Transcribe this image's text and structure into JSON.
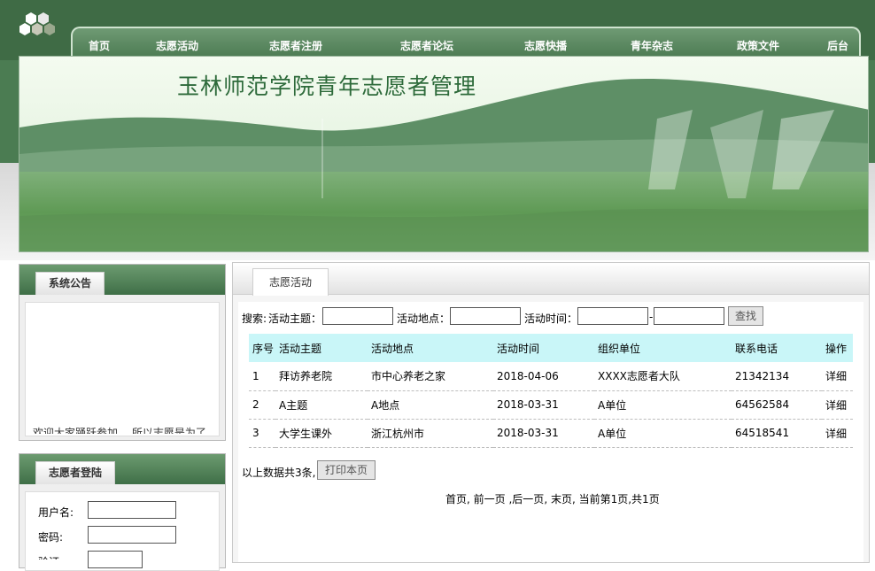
{
  "nav": {
    "items": [
      "首页",
      "志愿活动",
      "志愿者注册",
      "志愿者论坛",
      "志愿快播",
      "青年杂志",
      "政策文件",
      "后台"
    ]
  },
  "banner": {
    "title": "玉林师范学院青年志愿者管理"
  },
  "notice": {
    "title": "系统公告",
    "scroll_text": "欢迎大家踊跃参加，   所以志愿是为了"
  },
  "login": {
    "title": "志愿者登陆",
    "username_label": "用户名:",
    "password_label": "密码:",
    "captcha_label": "验证"
  },
  "main": {
    "tab": "志愿活动",
    "search": {
      "prefix": "搜索:",
      "topic_label": "活动主题：",
      "place_label": "活动地点：",
      "time_label": "活动时间：",
      "separator": "-",
      "button": "查找"
    },
    "table": {
      "headers": [
        "序号",
        "活动主题",
        "活动地点",
        "活动时间",
        "组织单位",
        "联系电话",
        "操作"
      ],
      "rows": [
        [
          "1",
          "拜访养老院",
          "市中心养老之家",
          "2018-04-06",
          "XXXX志愿者大队",
          "21342134",
          "详细"
        ],
        [
          "2",
          "A主题",
          "A地点",
          "2018-03-31",
          "A单位",
          "64562584",
          "详细"
        ],
        [
          "3",
          "大学生课外",
          "浙江杭州市",
          "2018-03-31",
          "A单位",
          "64518541",
          "详细"
        ]
      ]
    },
    "summary": "以上数据共3条,",
    "print_button": "打印本页",
    "pager": {
      "first": "首页",
      "prev": " 前一页",
      "next": " ,后一页",
      "last": " 末页",
      "status": " 当前第1页,共1页"
    }
  },
  "colors": {
    "nav_green": "#3f6b45",
    "header_cyan": "#c9f6f8"
  }
}
